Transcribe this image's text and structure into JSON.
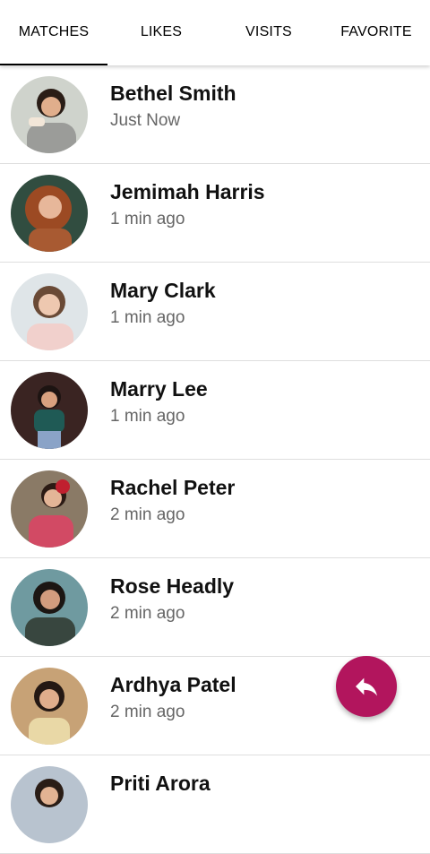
{
  "tabs": [
    "MATCHES",
    "LIKES",
    "VISITS",
    "FAVORITE"
  ],
  "active_tab": "MATCHES",
  "matches": [
    {
      "name": "Bethel Smith",
      "time": "Just Now"
    },
    {
      "name": "Jemimah Harris",
      "time": "1 min ago"
    },
    {
      "name": "Mary Clark",
      "time": "1 min ago"
    },
    {
      "name": "Marry Lee",
      "time": "1 min ago"
    },
    {
      "name": "Rachel Peter",
      "time": "2 min ago"
    },
    {
      "name": "Rose Headly",
      "time": "2 min ago"
    },
    {
      "name": "Ardhya Patel",
      "time": "2 min ago"
    },
    {
      "name": "Priti Arora",
      "time": ""
    }
  ],
  "fab": {
    "icon": "reply-icon",
    "color": "#b2155d"
  },
  "colors": {
    "accent": "#b2155d",
    "divider": "#dedede",
    "subtext": "#666666"
  }
}
